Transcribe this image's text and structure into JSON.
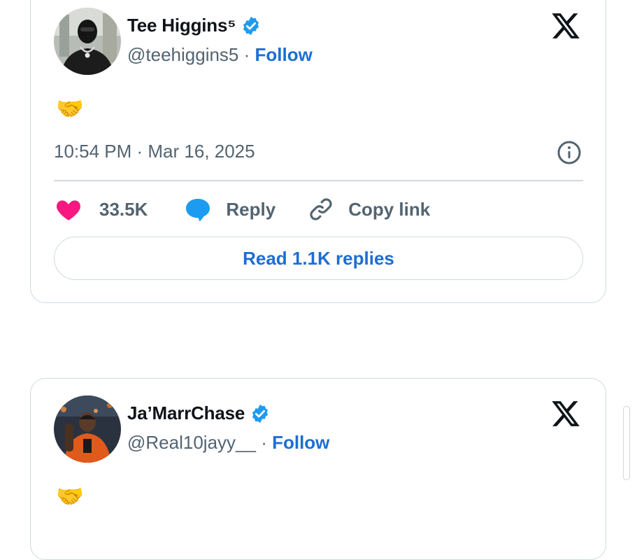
{
  "tweets": [
    {
      "name": "Tee Higgins⁵",
      "handle": "@teehiggins5",
      "follow_label": "Follow",
      "separator": "·",
      "body_emoji": "🤝",
      "timestamp": "10:54 PM · Mar 16, 2025",
      "likes": "33.5K",
      "reply_label": "Reply",
      "copy_link_label": "Copy link",
      "read_replies_label": "Read 1.1K replies",
      "avatar_icon": "profile-photo-masked-person"
    },
    {
      "name": "Ja’MarrChase",
      "handle": "@Real10jayy__",
      "follow_label": "Follow",
      "separator": "·",
      "body_emoji": "🤝",
      "avatar_icon": "profile-photo-football-player"
    }
  ],
  "colors": {
    "accent": "#1d6ed4",
    "verified": "#1d9bf0",
    "heart": "#f91880",
    "muted": "#536471",
    "border": "#cfd9de"
  },
  "icons": [
    "x-logo-icon",
    "verified-badge-icon",
    "info-icon",
    "heart-icon",
    "reply-bubble-icon",
    "link-icon"
  ]
}
